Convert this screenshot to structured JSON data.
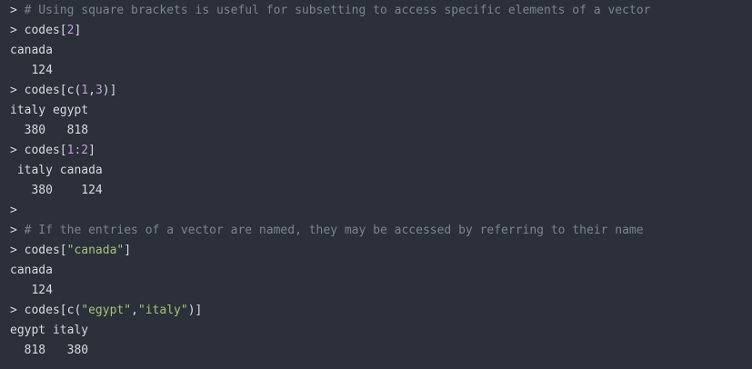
{
  "console": {
    "prompt": ">",
    "lines": [
      {
        "type": "comment",
        "text": "# Using square brackets is useful for subsetting to access specific elements of a vector"
      },
      {
        "type": "input",
        "parts": [
          {
            "t": "codes[",
            "c": "punc"
          },
          {
            "t": "2",
            "c": "num"
          },
          {
            "t": "]",
            "c": "punc"
          }
        ]
      },
      {
        "type": "output",
        "text": "canada"
      },
      {
        "type": "output",
        "text": "   124"
      },
      {
        "type": "input",
        "parts": [
          {
            "t": "codes[c(",
            "c": "punc"
          },
          {
            "t": "1",
            "c": "num"
          },
          {
            "t": ",",
            "c": "punc"
          },
          {
            "t": "3",
            "c": "num"
          },
          {
            "t": ")]",
            "c": "punc"
          }
        ]
      },
      {
        "type": "output",
        "text": "italy egypt"
      },
      {
        "type": "output",
        "text": "  380   818"
      },
      {
        "type": "input",
        "parts": [
          {
            "t": "codes[",
            "c": "punc"
          },
          {
            "t": "1:2",
            "c": "num"
          },
          {
            "t": "]",
            "c": "punc"
          }
        ]
      },
      {
        "type": "output",
        "text": " italy canada"
      },
      {
        "type": "output",
        "text": "   380    124"
      },
      {
        "type": "input",
        "parts": []
      },
      {
        "type": "comment",
        "text": "# If the entries of a vector are named, they may be accessed by referring to their name"
      },
      {
        "type": "input",
        "parts": [
          {
            "t": "codes[",
            "c": "punc"
          },
          {
            "t": "\"canada\"",
            "c": "str"
          },
          {
            "t": "]",
            "c": "punc"
          }
        ]
      },
      {
        "type": "output",
        "text": "canada"
      },
      {
        "type": "output",
        "text": "   124"
      },
      {
        "type": "input",
        "parts": [
          {
            "t": "codes[c(",
            "c": "punc"
          },
          {
            "t": "\"egypt\"",
            "c": "str"
          },
          {
            "t": ",",
            "c": "punc"
          },
          {
            "t": "\"italy\"",
            "c": "str"
          },
          {
            "t": ")]",
            "c": "punc"
          }
        ]
      },
      {
        "type": "output",
        "text": "egypt italy"
      },
      {
        "type": "output",
        "text": "  818   380"
      }
    ]
  }
}
